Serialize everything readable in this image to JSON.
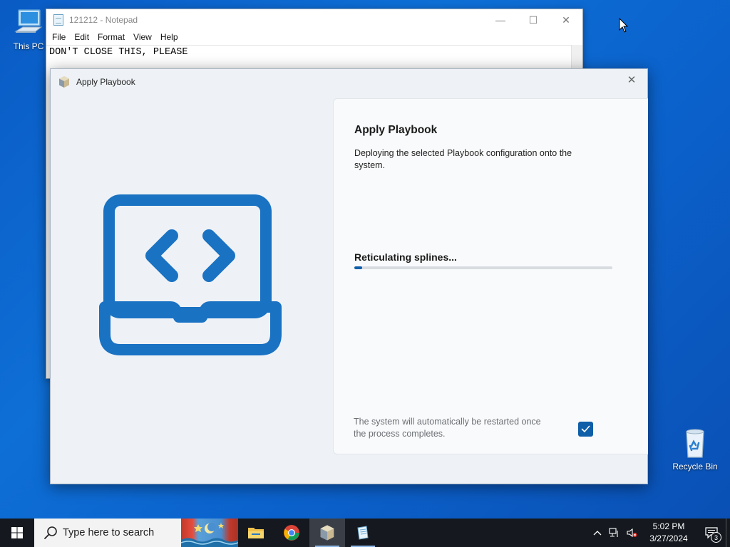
{
  "desktop": {
    "icons": [
      {
        "label": "This PC",
        "icon": "computer-icon"
      },
      {
        "label": "Recycle Bin",
        "icon": "recycle-bin-icon"
      }
    ]
  },
  "notepad": {
    "title": "121212 - Notepad",
    "menu": [
      "File",
      "Edit",
      "Format",
      "View",
      "Help"
    ],
    "content": "DON'T CLOSE THIS, PLEASE"
  },
  "dialog": {
    "title": "Apply Playbook",
    "heading": "Apply Playbook",
    "description": "Deploying the selected Playbook configuration onto the system.",
    "status": "Reticulating splines...",
    "progress_fraction": 0.03,
    "restart_note": "The system will automatically be restarted once the process completes.",
    "restart_checked": true,
    "accent_color": "#0f5ea8"
  },
  "taskbar": {
    "search_placeholder": "Type here to search",
    "apps": [
      "file-explorer-icon",
      "chrome-icon",
      "playbook-app-icon",
      "notepad-icon"
    ],
    "clock": {
      "time": "5:02 PM",
      "date": "3/27/2024"
    },
    "notification_count": "3"
  }
}
